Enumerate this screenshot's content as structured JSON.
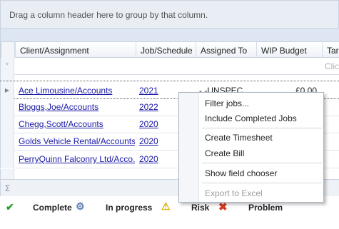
{
  "group_panel": {
    "text": "Drag a column header here to group by that column."
  },
  "columns": [
    "Client/Assignment",
    "Job/Schedule",
    "Assigned To",
    "WIP Budget",
    "Targ"
  ],
  "new_row": {
    "marker": "*",
    "hint": "Clic"
  },
  "rows": [
    {
      "client": "Ace Limousine/Accounts",
      "job": "2021",
      "assigned": "- -UNSPEC",
      "wip": "£0.00",
      "current": true
    },
    {
      "client": "Bloggs,Joe/Accounts",
      "job": "2022",
      "assigned": "",
      "wip": ""
    },
    {
      "client": "Chegg,Scott/Accounts",
      "job": "2020",
      "assigned": "",
      "wip": ""
    },
    {
      "client": "Golds Vehicle Rental/Accounts",
      "job": "2020",
      "assigned": "",
      "wip": ""
    },
    {
      "client": "PerryQuinn Falconry Ltd/Acco...",
      "job": "2020",
      "assigned": "",
      "wip": ""
    }
  ],
  "footer": {
    "sigma": "Σ"
  },
  "legend": {
    "complete": "Complete",
    "in_progress": "In progress",
    "risk": "Risk",
    "problem": "Problem",
    "icons": [
      "check-icon",
      "gear-icon",
      "warning-icon",
      "cross-icon"
    ]
  },
  "context_menu": {
    "filter_jobs": "Filter jobs...",
    "include_completed": "Include Completed Jobs",
    "create_timesheet": "Create Timesheet",
    "create_bill": "Create Bill",
    "show_field_chooser": "Show field chooser",
    "export_excel": "Export to Excel"
  },
  "colors": {
    "link": "#1a1aa6",
    "header_bg": "#e9eef5",
    "check": "#2a9d2a",
    "warning": "#e0b000",
    "cross": "#d83a1f"
  }
}
